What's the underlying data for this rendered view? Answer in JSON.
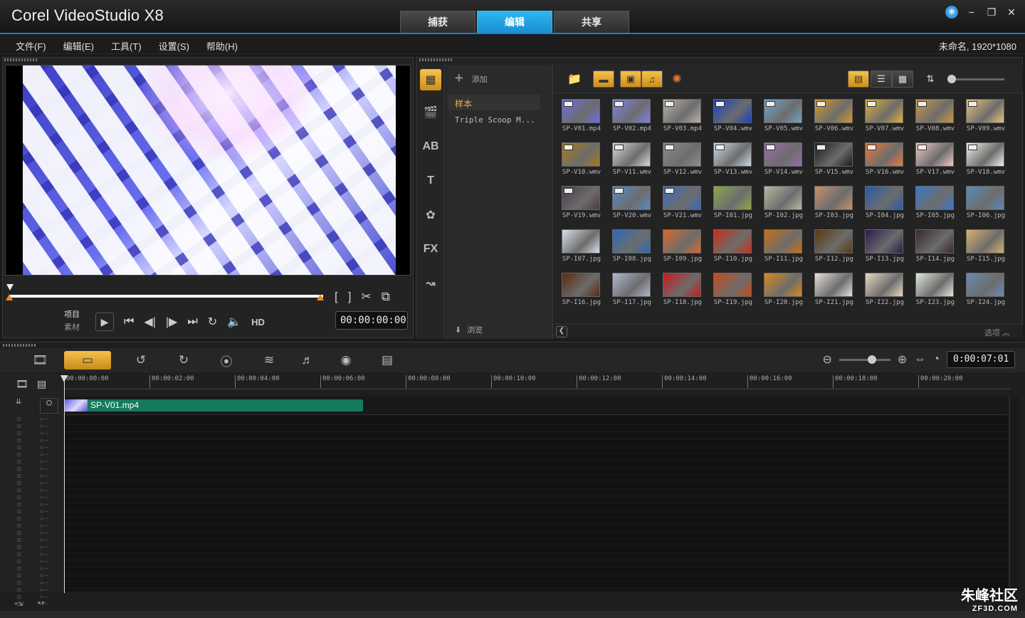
{
  "app": {
    "title": "Corel VideoStudio X8"
  },
  "tabs": [
    {
      "label": "捕获"
    },
    {
      "label": "编辑"
    },
    {
      "label": "共享"
    }
  ],
  "menu": [
    "文件(F)",
    "编辑(E)",
    "工具(T)",
    "设置(S)",
    "帮助(H)"
  ],
  "project_info": "未命名, 1920*1080",
  "preview": {
    "mode_project": "项目",
    "mode_clip": "素材",
    "hd": "HD",
    "timecode": "00:00:00:00"
  },
  "library": {
    "add_label": "添加",
    "folders": [
      "样本",
      "Triple Scoop M..."
    ],
    "browse_label": "浏览",
    "options_label": "选项",
    "media": [
      {
        "name": "SP-V01.mp4",
        "color": "#6d6ee0"
      },
      {
        "name": "SP-V02.mp4",
        "color": "#7c82e6"
      },
      {
        "name": "SP-V03.mp4",
        "color": "#b9b3a6"
      },
      {
        "name": "SP-V04.wmv",
        "color": "#1a3fc0"
      },
      {
        "name": "SP-V05.wmv",
        "color": "#6fa4c8"
      },
      {
        "name": "SP-V06.wmv",
        "color": "#d49a2a"
      },
      {
        "name": "SP-V07.wmv",
        "color": "#e0b23a"
      },
      {
        "name": "SP-V08.wmv",
        "color": "#c79848"
      },
      {
        "name": "SP-V09.wmv",
        "color": "#e8c27a"
      },
      {
        "name": "SP-V10.wmv",
        "color": "#a8781a"
      },
      {
        "name": "SP-V11.wmv",
        "color": "#d8d8d8"
      },
      {
        "name": "SP-V12.wmv",
        "color": "#8c8c8c"
      },
      {
        "name": "SP-V13.wmv",
        "color": "#d0d8e8"
      },
      {
        "name": "SP-V14.wmv",
        "color": "#9a6ab0"
      },
      {
        "name": "SP-V15.wmv",
        "color": "#1a1a1a"
      },
      {
        "name": "SP-V16.wmv",
        "color": "#e87a3a"
      },
      {
        "name": "SP-V17.wmv",
        "color": "#f0c8c0"
      },
      {
        "name": "SP-V18.wmv",
        "color": "#f2f0e8"
      },
      {
        "name": "SP-V19.wmv",
        "color": "#4a3a48"
      },
      {
        "name": "SP-V20.wmv",
        "color": "#5a8ac8"
      },
      {
        "name": "SP-V21.wmv",
        "color": "#3a6ab8"
      },
      {
        "name": "SP-I01.jpg",
        "color": "#8aa84a"
      },
      {
        "name": "SP-I02.jpg",
        "color": "#b8b8a0"
      },
      {
        "name": "SP-I03.jpg",
        "color": "#c8906a"
      },
      {
        "name": "SP-I04.jpg",
        "color": "#2a5aa8"
      },
      {
        "name": "SP-I05.jpg",
        "color": "#3a7ac8"
      },
      {
        "name": "SP-I06.jpg",
        "color": "#5a8ab8"
      },
      {
        "name": "SP-I07.jpg",
        "color": "#d8e0e8"
      },
      {
        "name": "SP-I08.jpg",
        "color": "#2a6ab8"
      },
      {
        "name": "SP-I09.jpg",
        "color": "#d86a2a"
      },
      {
        "name": "SP-I10.jpg",
        "color": "#c8301a"
      },
      {
        "name": "SP-I11.jpg",
        "color": "#c8701a"
      },
      {
        "name": "SP-I12.jpg",
        "color": "#5a3a10"
      },
      {
        "name": "SP-I13.jpg",
        "color": "#2a1a4a"
      },
      {
        "name": "SP-I14.jpg",
        "color": "#3a2a2a"
      },
      {
        "name": "SP-I15.jpg",
        "color": "#d8b070"
      },
      {
        "name": "SP-I16.jpg",
        "color": "#5a2a10"
      },
      {
        "name": "SP-I17.jpg",
        "color": "#b0b8d0"
      },
      {
        "name": "SP-I18.jpg",
        "color": "#c81a1a"
      },
      {
        "name": "SP-I19.jpg",
        "color": "#c84a1a"
      },
      {
        "name": "SP-I20.jpg",
        "color": "#d88a1a"
      },
      {
        "name": "SP-I21.jpg",
        "color": "#e8e0d8"
      },
      {
        "name": "SP-I22.jpg",
        "color": "#e8d8c0"
      },
      {
        "name": "SP-I23.jpg",
        "color": "#e0e8d8"
      },
      {
        "name": "SP-I24.jpg",
        "color": "#6a8ab0"
      }
    ]
  },
  "timeline": {
    "timecode": "0:00:07:01",
    "ruler": [
      "00:00:00:00",
      "00:00:02:00",
      "00:00:04:00",
      "00:00:06:00",
      "00:00:08:00",
      "00:00:10:00",
      "00:00:12:00",
      "00:00:14:00",
      "00:00:16:00",
      "00:00:18:00",
      "00:00:20:00"
    ],
    "clip_name": "SP-V01.mp4"
  },
  "watermark": {
    "line1": "朱峰社区",
    "line2": "ZF3D.COM"
  }
}
